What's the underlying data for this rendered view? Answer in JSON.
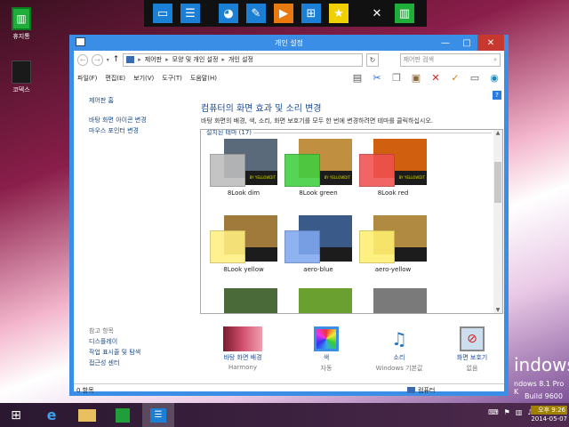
{
  "desktop": {
    "icons": [
      {
        "label": "휴지통"
      },
      {
        "label": "코덱스"
      }
    ],
    "brand": {
      "big": "indows",
      "edition": "ndows 8.1 Pro K",
      "build": "Build 9600"
    }
  },
  "window": {
    "title": "개인 설정",
    "breadcrumb": [
      "제어판",
      "모양 및 개인 설정",
      "개인 설정"
    ],
    "search_placeholder": "제어판 검색",
    "menu": [
      "파일(F)",
      "편집(E)",
      "보기(V)",
      "도구(T)",
      "도움말(H)"
    ],
    "left_pane": {
      "home": "제어판 홈",
      "links": [
        "바탕 화면 아이콘 변경",
        "마우스 포인터 변경"
      ],
      "see_also_title": "참고 항목",
      "see_also": [
        "디스플레이",
        "작업 표시줄 및 탐색",
        "접근성 센터"
      ]
    },
    "heading": "컴퓨터의 화면 효과 및 소리 변경",
    "description": "바탕 화면의 배경, 색, 소리, 화면 보호기를 모두 한 번에 변경하려면 테마를 클릭하십시오.",
    "group_label": "설치된 테마 (17)",
    "themes": [
      {
        "label": "8Look dim",
        "swatch": "#bdbdbd",
        "bg": "#5a6a7a",
        "logo_text": "BY YELLOWDIT"
      },
      {
        "label": "8Look green",
        "swatch": "#3fcf3f",
        "bg": "#c09040",
        "logo_text": "BY YELLOWDIT"
      },
      {
        "label": "8Look red",
        "swatch": "#f05050",
        "bg": "#d06010",
        "logo_text": "BY YELLOWDIT"
      },
      {
        "label": "8Look yellow",
        "swatch": "#fff080",
        "bg": "#a07a3a",
        "logo_text": ""
      },
      {
        "label": "aero-blue",
        "swatch": "#80a8f0",
        "bg": "#3a5a8a",
        "logo_text": ""
      },
      {
        "label": "aero-yellow",
        "swatch": "#fff070",
        "bg": "#b08a40",
        "logo_text": ""
      },
      {
        "label": "",
        "swatch": "",
        "bg": "#4a6a3a",
        "logo_text": ""
      },
      {
        "label": "",
        "swatch": "",
        "bg": "#6aa030",
        "logo_text": ""
      },
      {
        "label": "",
        "swatch": "",
        "bg": "#7a7a7a",
        "logo_text": ""
      }
    ],
    "bottom_items": [
      {
        "title": "바탕 화면 배경",
        "subtitle": "Harmony",
        "icon": "desktop-background-icon"
      },
      {
        "title": "색",
        "subtitle": "자동",
        "icon": "color-icon"
      },
      {
        "title": "소리",
        "subtitle": "Windows 기본값",
        "icon": "sound-icon"
      },
      {
        "title": "화면 보호기",
        "subtitle": "없음",
        "icon": "screensaver-icon"
      }
    ],
    "status": {
      "items": "0 항목",
      "location": "컴퓨터"
    }
  },
  "taskbar": {
    "time": "오후 9:26",
    "date": "2014-05-07",
    "ime": "A"
  },
  "colors": {
    "accent": "#3a8ee6",
    "close": "#c7392e",
    "link": "#1a4a9a"
  }
}
